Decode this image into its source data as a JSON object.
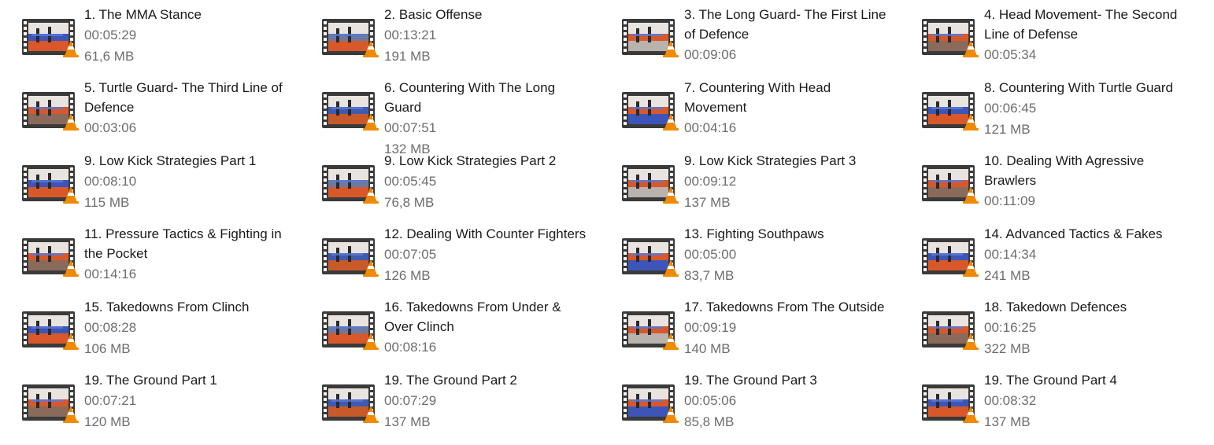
{
  "files": [
    {
      "title": "1. The MMA Stance",
      "duration": "00:05:29",
      "size": "61,6 MB"
    },
    {
      "title": "2. Basic Offense",
      "duration": "00:13:21",
      "size": "191 MB"
    },
    {
      "title": "3. The Long Guard- The First Line of Defence",
      "duration": "00:09:06",
      "size": ""
    },
    {
      "title": "4. Head Movement- The Second Line of Defense",
      "duration": "00:05:34",
      "size": ""
    },
    {
      "title": "5. Turtle Guard- The Third Line of Defence",
      "duration": "00:03:06",
      "size": ""
    },
    {
      "title": "6. Countering With The Long Guard",
      "duration": "00:07:51",
      "size": "132 MB"
    },
    {
      "title": "7. Countering With Head Movement",
      "duration": "00:04:16",
      "size": ""
    },
    {
      "title": "8. Countering With Turtle Guard",
      "duration": "00:06:45",
      "size": "121 MB"
    },
    {
      "title": "9. Low Kick Strategies Part 1",
      "duration": "00:08:10",
      "size": "115 MB"
    },
    {
      "title": "9. Low Kick Strategies Part 2",
      "duration": "00:05:45",
      "size": "76,8 MB"
    },
    {
      "title": "9. Low Kick Strategies Part 3",
      "duration": "00:09:12",
      "size": "137 MB"
    },
    {
      "title": "10. Dealing With Agressive Brawlers",
      "duration": "00:11:09",
      "size": ""
    },
    {
      "title": "11. Pressure Tactics & Fighting in the Pocket",
      "duration": "00:14:16",
      "size": ""
    },
    {
      "title": "12. Dealing With Counter Fighters",
      "duration": "00:07:05",
      "size": "126 MB"
    },
    {
      "title": "13. Fighting Southpaws",
      "duration": "00:05:00",
      "size": "83,7 MB"
    },
    {
      "title": "14. Advanced Tactics & Fakes",
      "duration": "00:14:34",
      "size": "241 MB"
    },
    {
      "title": "15. Takedowns From Clinch",
      "duration": "00:08:28",
      "size": "106 MB"
    },
    {
      "title": "16. Takedowns From Under & Over Clinch",
      "duration": "00:08:16",
      "size": ""
    },
    {
      "title": "17. Takedowns From The Outside",
      "duration": "00:09:19",
      "size": "140 MB"
    },
    {
      "title": "18. Takedown Defences",
      "duration": "00:16:25",
      "size": "322 MB"
    },
    {
      "title": "19. The Ground Part 1",
      "duration": "00:07:21",
      "size": "120 MB"
    },
    {
      "title": "19. The Ground Part 2",
      "duration": "00:07:29",
      "size": "137 MB"
    },
    {
      "title": "19. The Ground Part 3",
      "duration": "00:05:06",
      "size": "85,8 MB"
    },
    {
      "title": "19. The Ground Part 4",
      "duration": "00:08:32",
      "size": "137 MB"
    }
  ],
  "colors": {
    "title_text": "#1a1a1a",
    "meta_text": "#6d6d6d",
    "film_strip": "#3a3a3a",
    "vlc_orange": "#f08a00",
    "mat_orange": "#d8582a",
    "mat_blue": "#3d55b8"
  },
  "icons": {
    "thumbnail": "video-film-strip-icon",
    "badge": "vlc-cone-icon"
  }
}
